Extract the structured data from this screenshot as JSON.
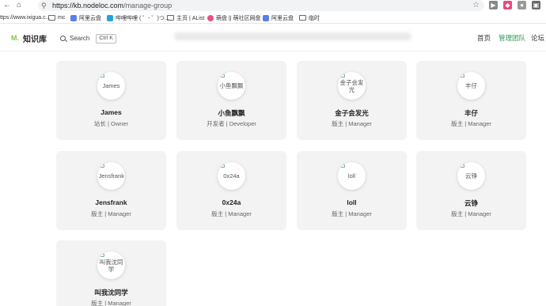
{
  "browser": {
    "url_host": "https://kb.nodeloc.com",
    "url_path": "/manage-group",
    "bookmarks": [
      {
        "label": "ttps://www.ixigua.c...",
        "icon": "page-icon"
      },
      {
        "label": "mc",
        "icon": "folder-icon"
      },
      {
        "label": "阿里云盘",
        "icon": "aliyun-icon"
      },
      {
        "label": "哔哩哔哩 ( ゜- ゜)つ...",
        "icon": "bilibili-icon"
      },
      {
        "label": "主页 | AList",
        "icon": "folder-icon"
      },
      {
        "label": "萌盘 || 萌社区网盘",
        "icon": "mengpan-icon"
      },
      {
        "label": "阿里云盘",
        "icon": "aliyun-icon"
      },
      {
        "label": "临时",
        "icon": "folder-icon"
      }
    ]
  },
  "header": {
    "logo_mark": "M.",
    "logo_text": "知识库",
    "search_label": "Search",
    "search_shortcut": "Ctrl K",
    "nav": [
      {
        "label": "首页"
      },
      {
        "label": "管理团队"
      },
      {
        "label": "论坛"
      }
    ]
  },
  "members": [
    {
      "alt": "James",
      "name": "James",
      "role": "站长 | Owner"
    },
    {
      "alt": "小鱼飘飘",
      "name": "小鱼飘飘",
      "role": "开发者 | Developer"
    },
    {
      "alt": "金子会发光",
      "name": "金子会发光",
      "role": "版主 | Manager"
    },
    {
      "alt": "丰仔",
      "name": "丰仔",
      "role": "版主 | Manager"
    },
    {
      "alt": "Jensfrank",
      "name": "Jensfrank",
      "role": "版主 | Manager"
    },
    {
      "alt": "0x24a",
      "name": "0x24a",
      "role": "版主 | Manager"
    },
    {
      "alt": "loll",
      "name": "loll",
      "role": "版主 | Manager"
    },
    {
      "alt": "云铮",
      "name": "云铮",
      "role": "版主 | Manager"
    },
    {
      "alt": "叫我沈同学",
      "name": "叫我沈同学",
      "role": "版主 | Manager"
    }
  ],
  "colors": {
    "accent": "#2e9c54",
    "logo": "#8bc34a",
    "card_bg": "#f3f3f3"
  }
}
